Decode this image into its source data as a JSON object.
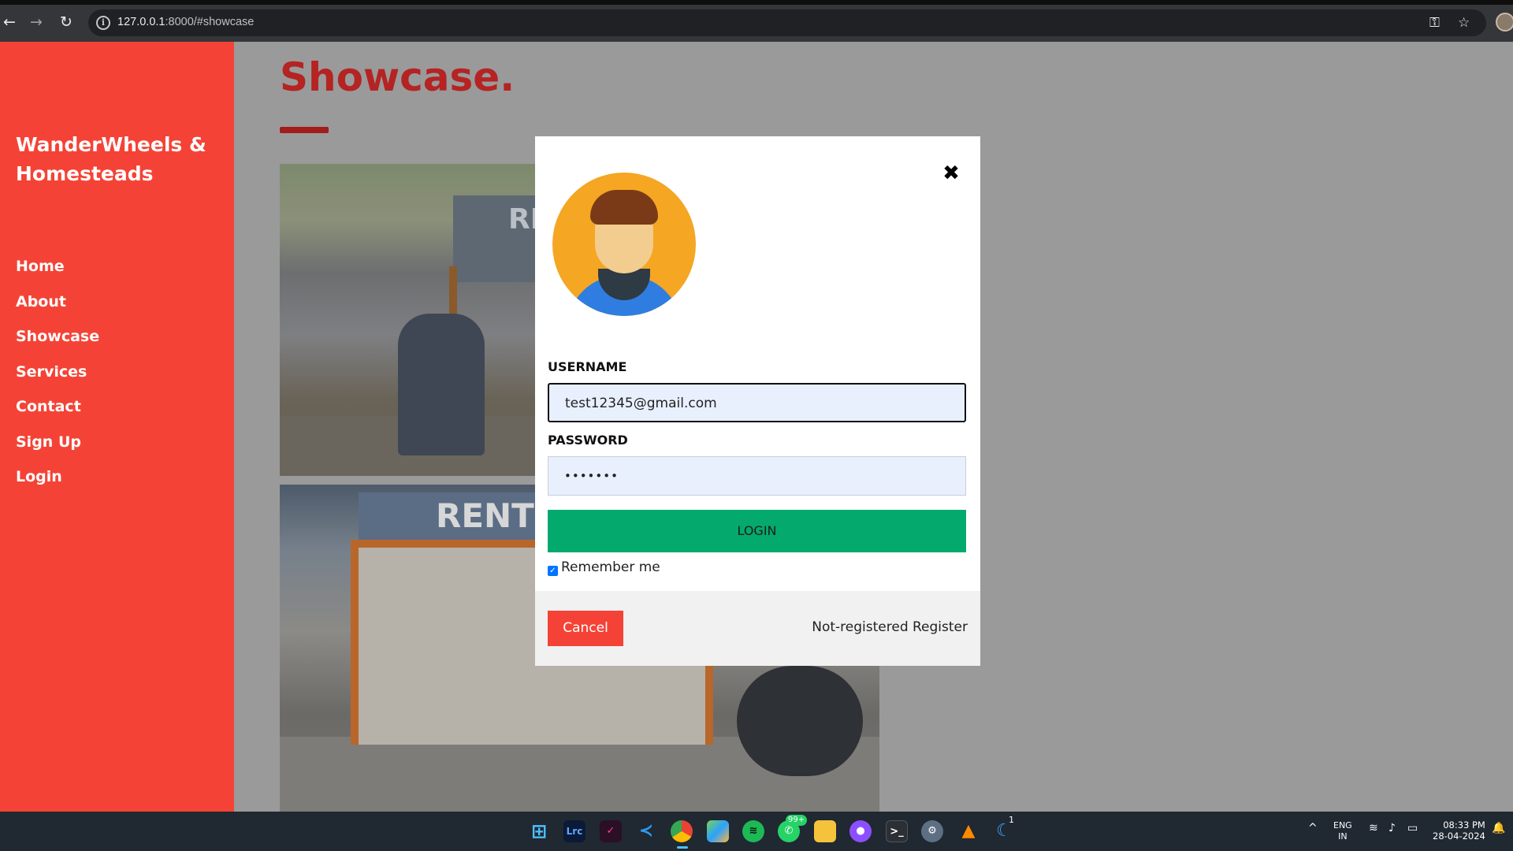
{
  "browser": {
    "url_host": "127.0.0.1",
    "url_rest": ":8000/#showcase"
  },
  "sidebar": {
    "brand": "WanderWheels & Homesteads",
    "items": [
      {
        "label": "Home"
      },
      {
        "label": "About"
      },
      {
        "label": "Showcase"
      },
      {
        "label": "Services"
      },
      {
        "label": "Contact"
      },
      {
        "label": "Sign Up"
      },
      {
        "label": "Login"
      }
    ]
  },
  "main": {
    "title": "Showcase.",
    "photo1_sign": "RI",
    "photo2_sign": "RENT"
  },
  "modal": {
    "close_glyph": "✖",
    "username_label": "USERNAME",
    "username_value": "test12345@gmail.com",
    "password_label": "PASSWORD",
    "password_value": "•••••••",
    "login_label": "LOGIN",
    "remember_label": "Remember me",
    "remember_checked": true,
    "cancel_label": "Cancel",
    "register_text": "Not-registered Register"
  },
  "taskbar": {
    "language": "ENG",
    "region": "IN",
    "time": "08:33 PM",
    "date": "28-04-2024",
    "whatsapp_badge": "99+",
    "notification_badge": "1"
  },
  "colors": {
    "sidebar": "#f44336",
    "login_button": "#04aa6d",
    "cancel_button": "#f44336",
    "title": "#b52323"
  }
}
